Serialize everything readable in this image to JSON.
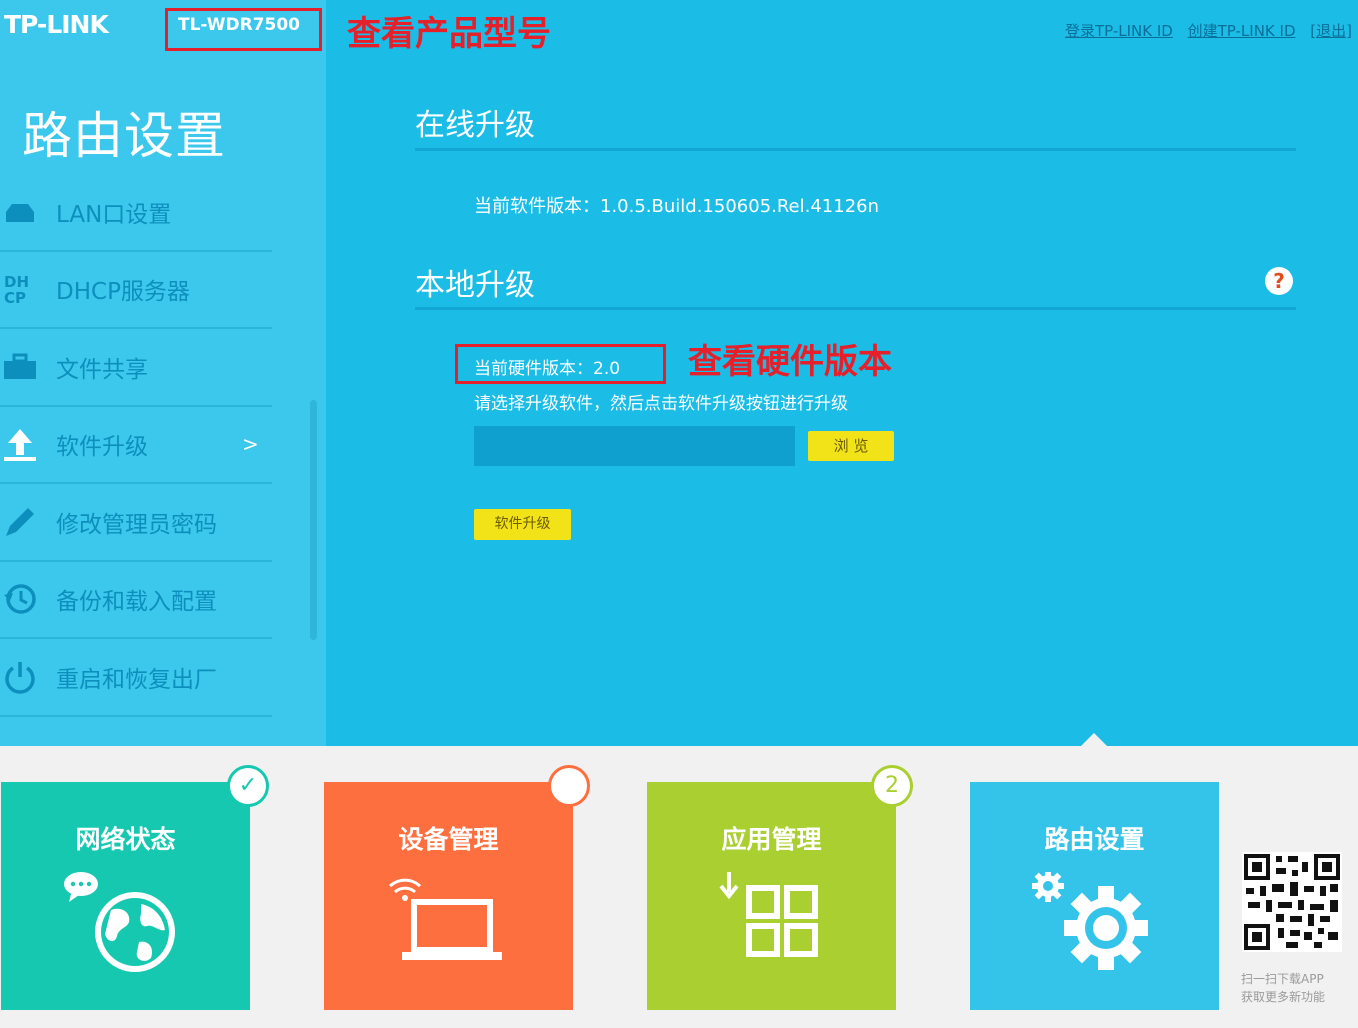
{
  "header": {
    "brand": "TP-LINK",
    "model": "TL-WDR7500",
    "annotation_model": "查看产品型号",
    "links": [
      "登录TP-LINK ID",
      "创建TP-LINK ID",
      "[退出]"
    ]
  },
  "sidebar": {
    "title": "路由设置",
    "items": [
      {
        "label": "LAN口设置",
        "icon": "lan-icon"
      },
      {
        "label": "DHCP服务器",
        "icon": "dhcp-icon"
      },
      {
        "label": "文件共享",
        "icon": "briefcase-icon"
      },
      {
        "label": "软件升级",
        "icon": "upload-icon",
        "arrow": ">"
      },
      {
        "label": "修改管理员密码",
        "icon": "pencil-icon"
      },
      {
        "label": "备份和载入配置",
        "icon": "history-icon"
      },
      {
        "label": "重启和恢复出厂",
        "icon": "power-icon"
      }
    ]
  },
  "main": {
    "online_title": "在线升级",
    "sw_version": "当前软件版本：1.0.5.Build.150605.Rel.41126n",
    "local_title": "本地升级",
    "help": "?",
    "hw_version": "当前硬件版本：2.0",
    "annotation_hw": "查看硬件版本",
    "hint": "请选择升级软件，然后点击软件升级按钮进行升级",
    "browse_label": "浏 览",
    "upgrade_label": "软件升级"
  },
  "tiles": [
    {
      "label": "网络状态",
      "color": "#16c8b0",
      "badge": "✓",
      "badge_color": "#16c8b0"
    },
    {
      "label": "设备管理",
      "color": "#fe6f3f",
      "badge": "",
      "badge_color": "#fe6f3f"
    },
    {
      "label": "应用管理",
      "color": "#a9cf31",
      "badge": "2",
      "badge_color": "#a9cf31"
    },
    {
      "label": "路由设置",
      "color": "#35c4e9"
    }
  ],
  "qr": {
    "line1": "扫一扫下载APP",
    "line2": "获取更多新功能"
  }
}
